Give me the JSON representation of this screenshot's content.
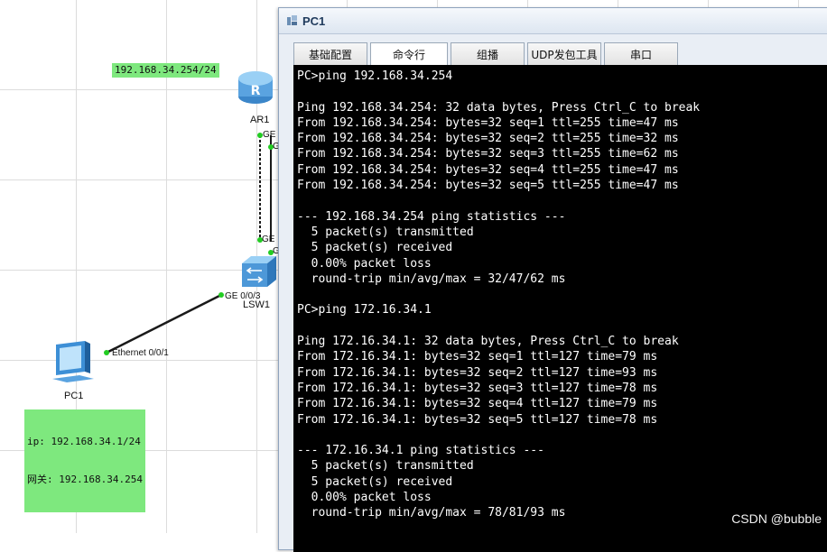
{
  "topology": {
    "router": {
      "name": "AR1",
      "ip_label": "192.168.34.254/24",
      "ports": [
        "GE",
        "G"
      ]
    },
    "switch": {
      "name": "LSW1",
      "ports": [
        "GE",
        "G",
        "GE 0/0/3"
      ]
    },
    "pc": {
      "name": "PC1",
      "port": "Ethernet 0/0/1",
      "ip_label": "ip: 192.168.34.1/24",
      "gateway_label": "网关: 192.168.34.254"
    },
    "colors": {
      "label_bg": "#7ee87e",
      "link": "#1a1a1a",
      "port_dot": "#22cc22"
    }
  },
  "window": {
    "title": "PC1",
    "tabs": [
      "基础配置",
      "命令行",
      "组播",
      "UDP发包工具",
      "串口"
    ],
    "active_tab": 1
  },
  "terminal": {
    "lines": [
      "PC>ping 192.168.34.254",
      "",
      "Ping 192.168.34.254: 32 data bytes, Press Ctrl_C to break",
      "From 192.168.34.254: bytes=32 seq=1 ttl=255 time=47 ms",
      "From 192.168.34.254: bytes=32 seq=2 ttl=255 time=32 ms",
      "From 192.168.34.254: bytes=32 seq=3 ttl=255 time=62 ms",
      "From 192.168.34.254: bytes=32 seq=4 ttl=255 time=47 ms",
      "From 192.168.34.254: bytes=32 seq=5 ttl=255 time=47 ms",
      "",
      "--- 192.168.34.254 ping statistics ---",
      "  5 packet(s) transmitted",
      "  5 packet(s) received",
      "  0.00% packet loss",
      "  round-trip min/avg/max = 32/47/62 ms",
      "",
      "PC>ping 172.16.34.1",
      "",
      "Ping 172.16.34.1: 32 data bytes, Press Ctrl_C to break",
      "From 172.16.34.1: bytes=32 seq=1 ttl=127 time=79 ms",
      "From 172.16.34.1: bytes=32 seq=2 ttl=127 time=93 ms",
      "From 172.16.34.1: bytes=32 seq=3 ttl=127 time=78 ms",
      "From 172.16.34.1: bytes=32 seq=4 ttl=127 time=79 ms",
      "From 172.16.34.1: bytes=32 seq=5 ttl=127 time=78 ms",
      "",
      "--- 172.16.34.1 ping statistics ---",
      "  5 packet(s) transmitted",
      "  5 packet(s) received",
      "  0.00% packet loss",
      "  round-trip min/avg/max = 78/81/93 ms"
    ]
  },
  "watermark": "CSDN @bubble"
}
